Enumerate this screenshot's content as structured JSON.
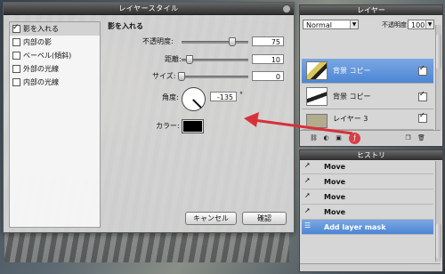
{
  "layer_style": {
    "title": "レイヤースタイル",
    "effects": [
      {
        "label": "影を入れる",
        "checked": true,
        "selected": true
      },
      {
        "label": "内部の影",
        "checked": false
      },
      {
        "label": "ベーベル(傾斜)",
        "checked": false
      },
      {
        "label": "外部の光線",
        "checked": false
      },
      {
        "label": "内部の光線",
        "checked": false
      }
    ],
    "section_title": "影を入れる",
    "opacity_label": "不透明度:",
    "opacity_value": "75",
    "distance_label": "距離:",
    "distance_value": "10",
    "size_label": "サイズ:",
    "size_value": "0",
    "angle_label": "角度:",
    "angle_value": "-135",
    "angle_unit": "°",
    "color_label": "カラー:",
    "shadow_color": "#000000",
    "cancel_label": "キャンセル",
    "ok_label": "確認"
  },
  "layers_panel": {
    "title": "レイヤー",
    "blend_mode": "Normal",
    "opacity_label": "不透明度:",
    "opacity_value": "100",
    "layers": [
      {
        "name": "背景 コピー",
        "selected": true,
        "visible": true
      },
      {
        "name": "背景 コピー",
        "selected": false,
        "visible": true
      },
      {
        "name": "レイヤー 3",
        "selected": false,
        "visible": true
      }
    ],
    "footer_icons": [
      "link-icon",
      "adjust-icon",
      "mask-icon",
      "effects-icon",
      "new-layer-icon",
      "trash-icon"
    ]
  },
  "history_panel": {
    "title": "ヒストリ",
    "items": [
      {
        "label": "Move",
        "selected": false
      },
      {
        "label": "Move",
        "selected": false
      },
      {
        "label": "Move",
        "selected": false
      },
      {
        "label": "Move",
        "selected": false
      },
      {
        "label": "Add layer mask",
        "selected": true
      },
      {
        "label": "",
        "selected": false
      }
    ]
  },
  "colors": {
    "selection": "#5a90da",
    "annotation_arrow": "#d8303a",
    "title_bar": "#3a3a3a"
  }
}
